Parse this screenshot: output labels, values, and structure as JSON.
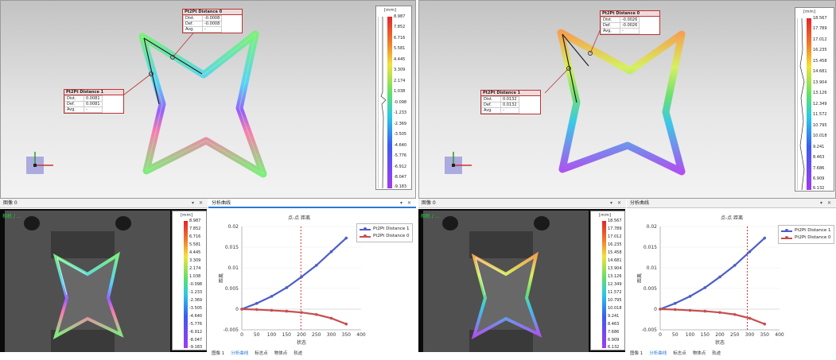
{
  "left": {
    "info0": {
      "title": "Pt2Pt Distance 0",
      "rows": [
        [
          "Dist.",
          "-0.0008"
        ],
        [
          "Def.",
          "-0.0008"
        ],
        [
          "Avg.",
          "-"
        ]
      ]
    },
    "info1": {
      "title": "Pt2Pt Distance 1",
      "rows": [
        [
          "Dist.",
          "0.0081"
        ],
        [
          "Def.",
          "0.0081"
        ],
        [
          "Avg.",
          "-"
        ]
      ]
    },
    "scale_unit": "[mm]",
    "scale_ticks": [
      "8.987",
      "7.852",
      "6.716",
      "5.581",
      "4.445",
      "3.309",
      "2.174",
      "1.038",
      "-0.098",
      "-1.233",
      "-2.369",
      "-3.505",
      "-4.640",
      "-5.776",
      "-6.912",
      "-8.047",
      "-9.183"
    ],
    "image_panel_title": "图像 0",
    "camera_label": "相机 / ...",
    "analysis_title": "分析曲线",
    "chart_title": "点-点 距离",
    "tabs": [
      "图像 1",
      "分析曲线",
      "标志点",
      "物体点",
      "轨迹"
    ]
  },
  "right": {
    "info0": {
      "title": "Pt2Pt Distance 0",
      "rows": [
        [
          "Dist.",
          "-0.0026"
        ],
        [
          "Def.",
          "-0.0026"
        ],
        [
          "Avg.",
          "-"
        ]
      ]
    },
    "info1": {
      "title": "Pt2Pt Distance 1",
      "rows": [
        [
          "Dist.",
          "0.0132"
        ],
        [
          "Def.",
          "0.0132"
        ],
        [
          "Avg.",
          "-"
        ]
      ]
    },
    "scale_unit": "[mm]",
    "scale_ticks": [
      "18.567",
      "17.789",
      "17.012",
      "16.235",
      "15.458",
      "14.681",
      "13.904",
      "13.126",
      "12.349",
      "11.572",
      "10.795",
      "10.018",
      "9.241",
      "8.463",
      "7.686",
      "6.909",
      "6.132"
    ],
    "image_panel_title": "图像 0",
    "camera_label": "相机 / ...",
    "analysis_title": "分析曲线",
    "chart_title": "点-点 距离",
    "tabs": [
      "图像 1",
      "分析曲线",
      "标志点",
      "物体点",
      "轨迹"
    ]
  },
  "chart_data": [
    {
      "type": "line",
      "title": "点-点 距离",
      "xlabel": "状态",
      "ylabel": "距离",
      "xlim": [
        0,
        400
      ],
      "ylim": [
        -0.005,
        0.02
      ],
      "xticks": [
        0,
        50,
        100,
        150,
        200,
        250,
        300,
        350,
        400
      ],
      "yticks": [
        -0.005,
        0,
        0.005,
        0.01,
        0.015,
        0.02
      ],
      "marker_x": 198,
      "series": [
        {
          "name": "Pt2Pt Distance 1",
          "color": "#4d5fc4",
          "x": [
            0,
            50,
            100,
            150,
            200,
            250,
            300,
            350
          ],
          "y": [
            0,
            0.0014,
            0.0031,
            0.0052,
            0.0078,
            0.0106,
            0.0139,
            0.0172
          ]
        },
        {
          "name": "Pt2Pt Distance 0",
          "color": "#c4504f",
          "x": [
            0,
            50,
            100,
            150,
            200,
            250,
            300,
            350
          ],
          "y": [
            0,
            -0.0001,
            -0.0003,
            -0.0005,
            -0.0008,
            -0.0013,
            -0.0022,
            -0.0036
          ]
        }
      ],
      "legend": "top-right"
    },
    {
      "type": "line",
      "title": "点-点 距离",
      "xlabel": "状态",
      "ylabel": "距离",
      "xlim": [
        0,
        400
      ],
      "ylim": [
        -0.005,
        0.02
      ],
      "xticks": [
        0,
        50,
        100,
        150,
        200,
        250,
        300,
        350,
        400
      ],
      "yticks": [
        -0.005,
        0,
        0.005,
        0.01,
        0.015,
        0.02
      ],
      "marker_x": 292,
      "series": [
        {
          "name": "Pt2Pt Distance 1",
          "color": "#4d5fc4",
          "x": [
            0,
            50,
            100,
            150,
            200,
            250,
            300,
            350
          ],
          "y": [
            0,
            0.0014,
            0.0031,
            0.0052,
            0.0078,
            0.0106,
            0.0139,
            0.0172
          ]
        },
        {
          "name": "Pt2Pt Distance 0",
          "color": "#c4504f",
          "x": [
            0,
            50,
            100,
            150,
            200,
            250,
            300,
            350
          ],
          "y": [
            0,
            -0.0001,
            -0.0003,
            -0.0005,
            -0.0008,
            -0.0013,
            -0.0022,
            -0.0036
          ]
        }
      ],
      "legend": "top-right"
    }
  ]
}
